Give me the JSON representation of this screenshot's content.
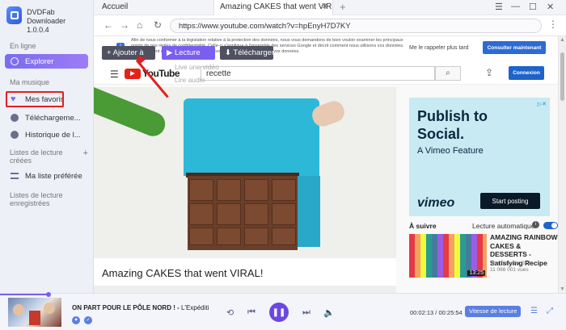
{
  "app": {
    "name": "DVDFab Downloader",
    "version": "1.0.0.4"
  },
  "sidebar": {
    "section_online": "En ligne",
    "explore": "Explorer",
    "section_music": "Ma musique",
    "favorites": "Mes favoris",
    "downloads": "Téléchargeme...",
    "history": "Historique de l...",
    "section_created": "Listes de lecture créées",
    "my_playlist": "Ma liste préférée",
    "section_saved": "Listes de lecture enregistrées"
  },
  "tabs": {
    "home": "Accueil",
    "active_title": "Amazing CAKES that went VIR",
    "close": "✕",
    "add": "+"
  },
  "window_controls": [
    "☰",
    "—",
    "☐",
    "✕"
  ],
  "address": {
    "url": "https://www.youtube.com/watch?v=hpEnyH7D7KY"
  },
  "nav_icons": {
    "back": "←",
    "forward": "→",
    "home": "⌂",
    "refresh": "↻",
    "more": "⋮"
  },
  "consent": {
    "text": "Afin de nous conformer à la législation relative à la protection des données, nous vous demandons de bien vouloir examiner les principaux points de nos règles de confidentialité. Celle-ci s'applique à l'ensemble des services Google et décrit comment nous utilisons vos données. Elles détaillent également les options dont vous disposez pour contrôler vos données.",
    "later": "Me le rappeler plus tard",
    "review": "Consulter maintenant"
  },
  "youtube": {
    "logo_text": "YouTube",
    "search_value": "recette",
    "login": "Connexion"
  },
  "actions": {
    "add": "+ Ajouter à",
    "play": "▶ Lecture",
    "download": "⬇ Télécharger",
    "ghost_1": "Live une vidéo",
    "ghost_2": "Lire audio"
  },
  "video": {
    "title": "Amazing CAKES that went VIRAL!"
  },
  "ad": {
    "title": "Publish to Social.",
    "subtitle": "A Vimeo Feature",
    "brand": "vimeo",
    "cta": "Start posting"
  },
  "up_next": {
    "label": "À suivre",
    "autoplay": "Lecture automatique",
    "title": "AMAZING RAINBOW CAKES & DESSERTS - Satisfying Recipe",
    "channel": "The Sweeter Side",
    "views": "11 066 001 vues",
    "duration": "13:25"
  },
  "player": {
    "title": "ON PART POUR LE PÔLE NORD ! - ",
    "artist": "L'Expéditi",
    "current_time": "00:02:13",
    "total_time": "00:25:54",
    "time_separator": "/",
    "speed_label": "Vitesse de lecture",
    "progress": 0.086
  },
  "colors": {
    "accent": "#7a5ef0",
    "brand_blue": "#1e63c9",
    "yt_red": "#e62117"
  }
}
